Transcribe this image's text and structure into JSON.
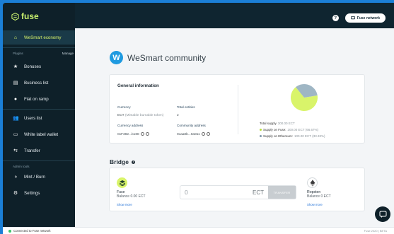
{
  "app": {
    "logo_text": "fuse"
  },
  "topbar": {
    "help_icon": "help-icon",
    "network_label": "Fuse network"
  },
  "sidebar": {
    "top_item": {
      "label": "WeSmart economy",
      "icon": "home-icon"
    },
    "plugins_label": "Plugins",
    "manage_label": "Manage",
    "plugins": [
      {
        "label": "Bonuses",
        "icon": "star-icon"
      },
      {
        "label": "Business list",
        "icon": "list-icon"
      },
      {
        "label": "Fiat on ramp",
        "icon": "dollar-icon"
      }
    ],
    "middle": [
      {
        "label": "Users list",
        "icon": "users-icon"
      },
      {
        "label": "White label wallet",
        "icon": "wallet-icon"
      },
      {
        "label": "Transfer",
        "icon": "transfer-icon"
      }
    ],
    "admin_label": "Admin tools",
    "admin": [
      {
        "label": "Mint / Burn",
        "icon": "mint-burn-icon"
      },
      {
        "label": "Settings",
        "icon": "gear-icon"
      }
    ]
  },
  "community": {
    "name": "WeSmart community",
    "logo_letter": "W"
  },
  "general": {
    "title": "General information",
    "currency_label": "Currency",
    "currency_value": "ECT",
    "currency_note": "(Mintable burnable token)",
    "entities_label": "Total entities",
    "entities_value": "2",
    "currency_address_label": "Currency address",
    "currency_address_value": "0xF382...b188",
    "community_address_label": "Community address",
    "community_address_value": "0xaa8b...0a811",
    "total_supply_label": "Total supply",
    "total_supply_value": "300.00 ECT",
    "fuse_supply_label": "Supply on Fuse:",
    "fuse_supply_value": "200.00 ECT (66.67%)",
    "eth_supply_label": "Supply on Ethereum:",
    "eth_supply_value": "100.00 ECT (33.33%)",
    "colors": {
      "fuse": "#d9f46a",
      "ethereum": "#9fb6c4"
    }
  },
  "bridge": {
    "title": "Bridge",
    "left": {
      "name": "Fuse",
      "balance": "Balance 0.00 ECT",
      "show_more": "Show more"
    },
    "amount_value": "0",
    "amount_unit": "ECT",
    "transfer_label": "TRANSFER",
    "right": {
      "name": "Ropsten",
      "balance": "Balance 0 ECT",
      "show_more": "Show more"
    }
  },
  "status": {
    "connection": "Connected to Fuse network",
    "footer": "Fuse 2020 | BETA"
  },
  "chart_data": {
    "type": "pie",
    "values": [
      200,
      100
    ],
    "colors": [
      "#d9f46a",
      "#9fb6c4"
    ]
  }
}
